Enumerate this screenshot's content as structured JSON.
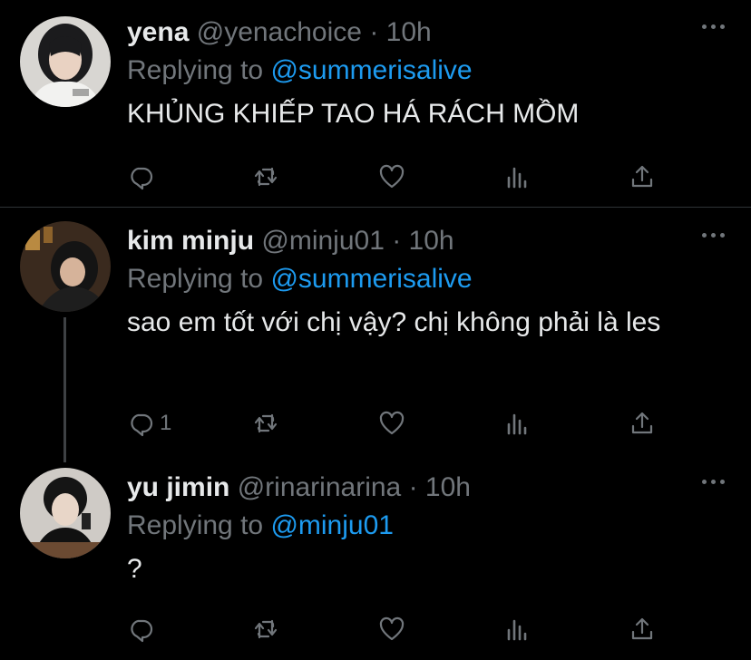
{
  "tweets": [
    {
      "name": "yena",
      "handle": "@yenachoice",
      "time": "· 10h",
      "replying_prefix": "Replying to",
      "replying_to": "@summerisalive",
      "text": "KHỦNG KHIẾP TAO HÁ RÁCH MỒM",
      "reply_count": ""
    },
    {
      "name": "kim minju",
      "handle": "@minju01",
      "time": "· 10h",
      "replying_prefix": "Replying to",
      "replying_to": "@summerisalive",
      "text": "sao em tốt với chị vậy? chị không phải là les",
      "reply_count": "1"
    },
    {
      "name": "yu jimin",
      "handle": "@rinarinarina",
      "time": "· 10h",
      "replying_prefix": "Replying to",
      "replying_to": "@minju01",
      "text": "?",
      "reply_count": ""
    }
  ],
  "icons": {
    "reply": "reply-icon",
    "retweet": "retweet-icon",
    "like": "like-icon",
    "views": "views-icon",
    "share": "share-icon",
    "more": "more-icon"
  },
  "colors": {
    "background": "#000000",
    "text": "#e7e9ea",
    "secondary": "#71767b",
    "link": "#1d9bf0",
    "divider": "#2f3336"
  }
}
